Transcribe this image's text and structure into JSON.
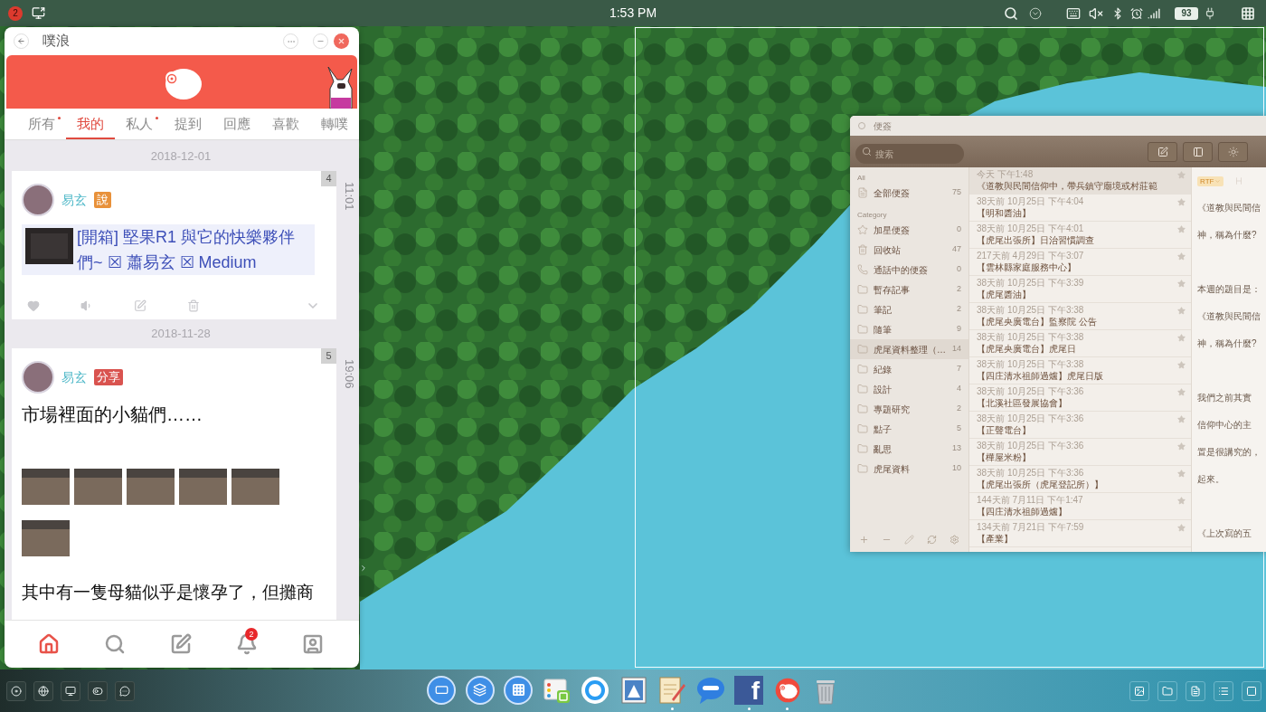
{
  "top_bar": {
    "notification_count": "2",
    "clock": "1:53 PM",
    "battery": "93"
  },
  "plurk_window": {
    "title": "噗浪",
    "tabs": [
      {
        "label": "所有",
        "selected": false,
        "unread": true
      },
      {
        "label": "我的",
        "selected": true,
        "unread": false
      },
      {
        "label": "私人",
        "selected": false,
        "unread": true
      },
      {
        "label": "提到",
        "selected": false,
        "unread": false
      },
      {
        "label": "回應",
        "selected": false,
        "unread": false
      },
      {
        "label": "喜歡",
        "selected": false,
        "unread": false
      },
      {
        "label": "轉噗",
        "selected": false,
        "unread": false
      }
    ],
    "posts": [
      {
        "date": "2018-12-01",
        "time": "11:01",
        "count": "4",
        "author": "易玄",
        "tag": {
          "label": "說",
          "color": "#e8913a"
        },
        "body": [
          {
            "kind": "link",
            "text": "[開箱] 堅果R1 與它的快樂夥伴們~ ☒ 蕭易玄 ☒ Medium"
          }
        ]
      },
      {
        "date": "2018-11-28",
        "time": "19:06",
        "count": "5",
        "author": "易玄",
        "tag": {
          "label": "分享",
          "color": "#d9534f"
        },
        "body": [
          {
            "kind": "text",
            "text": "市場裡面的小貓們……"
          },
          {
            "kind": "gallery"
          },
          {
            "kind": "text",
            "text": "其中有一隻母貓似乎是懷孕了，但攤商"
          }
        ]
      }
    ],
    "bottom_nav": [
      {
        "selected": true
      },
      {
        "selected": false
      },
      {
        "selected": false
      },
      {
        "selected": false,
        "badge": "2"
      },
      {
        "selected": false
      }
    ]
  },
  "notes_window": {
    "title": "便簽",
    "search": {
      "placeholder": "搜索"
    },
    "sidebar": [
      {
        "heading": "All",
        "items": [
          {
            "kind": "all",
            "label": "全部便簽",
            "count": "75",
            "selected": false
          }
        ]
      },
      {
        "heading": "Category",
        "items": [
          {
            "kind": "starred",
            "label": "加星便簽",
            "count": "0",
            "selected": false
          },
          {
            "kind": "trash",
            "label": "回收站",
            "count": "47",
            "selected": false
          },
          {
            "kind": "calls",
            "label": "通話中的便簽",
            "count": "0",
            "selected": false
          },
          {
            "kind": "folder",
            "label": "暫存記事",
            "count": "2",
            "selected": false
          },
          {
            "kind": "folder",
            "label": "筆記",
            "count": "2",
            "selected": false
          },
          {
            "kind": "folder",
            "label": "隨筆",
            "count": "9",
            "selected": false
          },
          {
            "kind": "folder",
            "label": "虎尾資料整理（…",
            "count": "14",
            "selected": true
          },
          {
            "kind": "folder",
            "label": "紀錄",
            "count": "7",
            "selected": false
          },
          {
            "kind": "folder",
            "label": "設計",
            "count": "4",
            "selected": false
          },
          {
            "kind": "folder",
            "label": "專題研究",
            "count": "2",
            "selected": false
          },
          {
            "kind": "folder",
            "label": "點子",
            "count": "5",
            "selected": false
          },
          {
            "kind": "folder",
            "label": "亂思",
            "count": "13",
            "selected": false
          },
          {
            "kind": "folder",
            "label": "虎尾資料",
            "count": "10",
            "selected": false
          }
        ]
      }
    ],
    "notes": [
      {
        "time": "今天 下午1:48",
        "title": "《道教與民間信仰中，帶兵鎮守廟境或村莊範",
        "selected": true,
        "starred": false
      },
      {
        "time": "38天前 10月25日 下午4:04",
        "title": "【明和醬油】",
        "selected": false,
        "starred": false
      },
      {
        "time": "38天前 10月25日 下午4:01",
        "title": "【虎尾出張所】日治習慣調查",
        "selected": false,
        "starred": false
      },
      {
        "time": "217天前 4月29日 下午3:07",
        "title": "【雲林縣家庭服務中心】",
        "selected": false,
        "starred": false
      },
      {
        "time": "38天前 10月25日 下午3:39",
        "title": "【虎尾醬油】",
        "selected": false,
        "starred": false
      },
      {
        "time": "38天前 10月25日 下午3:38",
        "title": "【虎尾央廣電台】監察院 公告",
        "selected": false,
        "starred": false
      },
      {
        "time": "38天前 10月25日 下午3:38",
        "title": "【虎尾央廣電台】虎尾日",
        "selected": false,
        "starred": false
      },
      {
        "time": "38天前 10月25日 下午3:38",
        "title": "【四庄清水祖師過爐】虎尾日版",
        "selected": false,
        "starred": false
      },
      {
        "time": "38天前 10月25日 下午3:36",
        "title": "【北溪社區發展協會】",
        "selected": false,
        "starred": false
      },
      {
        "time": "38天前 10月25日 下午3:36",
        "title": "【正聲電台】",
        "selected": false,
        "starred": false
      },
      {
        "time": "38天前 10月25日 下午3:36",
        "title": "【樺屋米粉】",
        "selected": false,
        "starred": false
      },
      {
        "time": "38天前 10月25日 下午3:36",
        "title": "【虎尾出張所（虎尾登記所）】",
        "selected": false,
        "starred": false
      },
      {
        "time": "144天前 7月11日 下午1:47",
        "title": "【四庄清水祖師過爐】",
        "selected": false,
        "starred": false
      },
      {
        "time": "134天前 7月21日 下午7:59",
        "title": "【產業】",
        "selected": false,
        "starred": false
      }
    ],
    "editor": {
      "format": "RTF",
      "paragraphs": [
        [
          "《道教與民間信",
          "神，稱為什麼?"
        ],
        [
          "本週的題目是：",
          "《道教與民間信",
          "神，稱為什麼?"
        ],
        [
          "我們之前其實",
          "信仰中心的主",
          "置是很講究的，",
          "起來。"
        ],
        [
          "《上次寫的五"
        ]
      ]
    }
  },
  "dock": {
    "apps": [
      {
        "running": false
      },
      {
        "running": false
      },
      {
        "running": false
      },
      {
        "running": false
      },
      {
        "running": false
      },
      {
        "running": false
      },
      {
        "running": true
      },
      {
        "running": false
      },
      {
        "running": true,
        "label": "f"
      },
      {
        "running": true
      },
      {
        "running": false
      }
    ]
  }
}
